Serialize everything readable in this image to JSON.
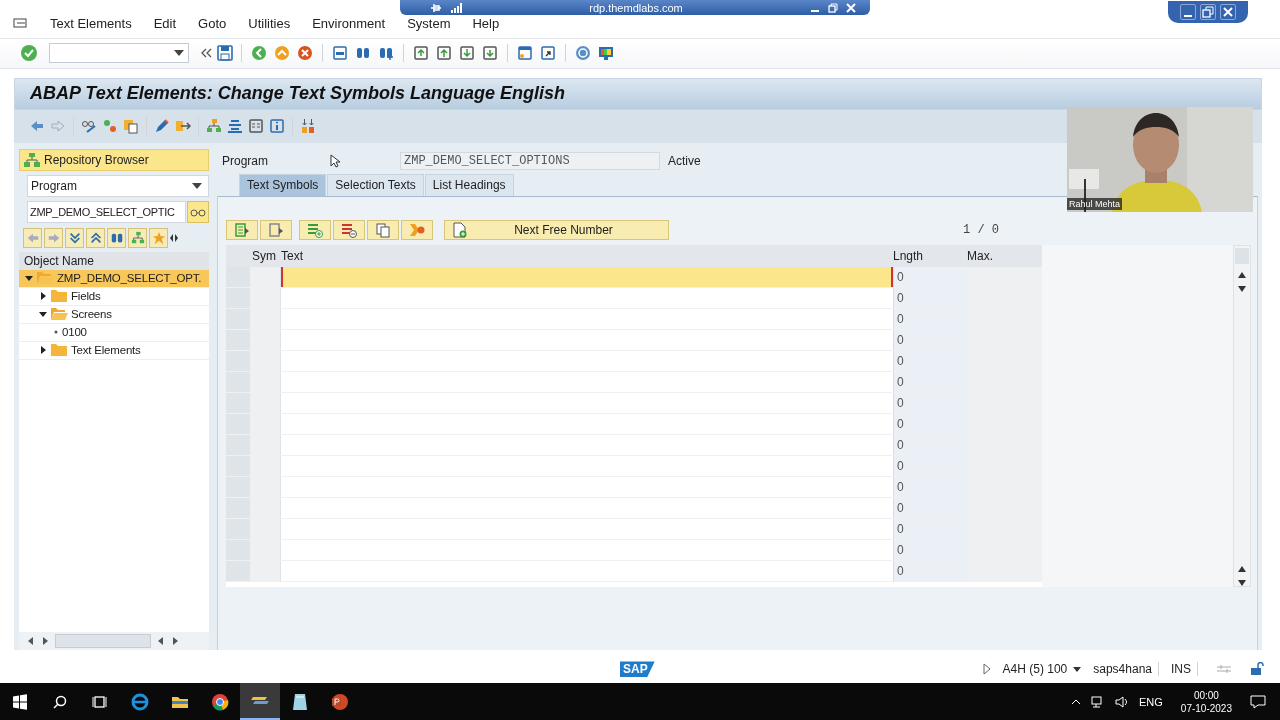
{
  "rdp_bar": {
    "host": "rdp.themdlabs.com"
  },
  "menu": [
    {
      "label": "Text Elements"
    },
    {
      "label": "Edit"
    },
    {
      "label": "Goto"
    },
    {
      "label": "Utilities"
    },
    {
      "label": "Environment"
    },
    {
      "label": "System"
    },
    {
      "label": "Help"
    }
  ],
  "title": "ABAP Text Elements: Change Text Symbols Language English",
  "left_pane": {
    "header": "Repository Browser",
    "object_type": "Program",
    "object_name": "ZMP_DEMO_SELECT_OPTIC",
    "column": "Object Name",
    "tree": [
      {
        "label": "ZMP_DEMO_SELECT_OPT.",
        "kind": "folder",
        "expanded": true,
        "selected": true,
        "children": [
          {
            "label": "Fields",
            "kind": "folder",
            "expanded": false,
            "selected": false
          },
          {
            "label": "Screens",
            "kind": "folder",
            "expanded": true,
            "selected": false,
            "children": [
              {
                "label": "0100",
                "kind": "leaf",
                "selected": false
              }
            ]
          },
          {
            "label": "Text Elements",
            "kind": "folder",
            "expanded": false,
            "selected": false
          }
        ]
      }
    ]
  },
  "program": {
    "label": "Program",
    "value": "ZMP_DEMO_SELECT_OPTIONS",
    "status": "Active"
  },
  "tabs": [
    {
      "label": "Text Symbols",
      "selected": true
    },
    {
      "label": "Selection Texts",
      "selected": false
    },
    {
      "label": "List Headings",
      "selected": false
    }
  ],
  "next_free_button": "Next Free Number",
  "counter": "1 / 0",
  "table": {
    "columns": [
      "Sym",
      "Text",
      "Lngth",
      "Max."
    ],
    "rows": [
      {
        "lngth": "0",
        "selected": true
      },
      {
        "lngth": "0",
        "selected": false
      },
      {
        "lngth": "0",
        "selected": false
      },
      {
        "lngth": "0",
        "selected": false
      },
      {
        "lngth": "0",
        "selected": false
      },
      {
        "lngth": "0",
        "selected": false
      },
      {
        "lngth": "0",
        "selected": false
      },
      {
        "lngth": "0",
        "selected": false
      },
      {
        "lngth": "0",
        "selected": false
      },
      {
        "lngth": "0",
        "selected": false
      },
      {
        "lngth": "0",
        "selected": false
      },
      {
        "lngth": "0",
        "selected": false
      },
      {
        "lngth": "0",
        "selected": false
      },
      {
        "lngth": "0",
        "selected": false
      },
      {
        "lngth": "0",
        "selected": false
      }
    ]
  },
  "webcam": {
    "name": "Rahul Mehta"
  },
  "status_bar": {
    "logo": "SAP",
    "system": "A4H (5) 100",
    "server": "saps4hana",
    "mode": "INS"
  },
  "taskbar": {
    "language": "ENG",
    "time": "00:00",
    "date": "07-10-2023"
  }
}
